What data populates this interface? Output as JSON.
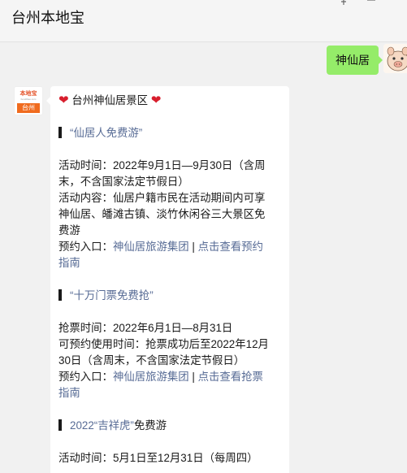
{
  "window": {
    "title": "台州本地宝",
    "pin_icon": "pin-icon",
    "minimize_icon": "minimize-icon"
  },
  "outgoing": {
    "text": "神仙居"
  },
  "incoming": {
    "avatar": {
      "brand": "本地宝",
      "domain": "bendibao.com",
      "city": "台州"
    },
    "header": "台州神仙居景区",
    "sec1": {
      "title": "“仙居人免费游”",
      "time_l1": "活动时间：2022年9月1日—9月30日（含周",
      "time_l2": "末，不含国家法定节假日）",
      "content_l1": "活动内容：仙居户籍市民在活动期间内可享",
      "content_l2": "神仙居、皤滩古镇、淡竹休闲谷三大景区免",
      "content_l3": "费游",
      "entry_label": "预约入口：",
      "entry_link1": "神仙居旅游集团",
      "entry_sep": " | ",
      "entry_link2_l1": "点击查看预约",
      "entry_link2_l2": "指南"
    },
    "sec2": {
      "title": "“十万门票免费抢”",
      "grab_time": "抢票时间：2022年6月1日—8月31日",
      "use_l1": "可预约使用时间：抢票成功后至2022年12月",
      "use_l2": "30日（含周末，不含国家法定节假日）",
      "entry_label": "预约入口：",
      "entry_link1": "神仙居旅游集团",
      "entry_sep": " | ",
      "entry_link2_l1": "点击查看抢票",
      "entry_link2_l2": "指南"
    },
    "sec3": {
      "title_accent": "2022“吉祥虎”",
      "title_rest": "免费游",
      "time_partial": "活动时间：5月1日至12月31日（每周四）"
    }
  },
  "colors": {
    "link": "#576b95",
    "outgoing_bubble": "#95ec69",
    "heart": "#d81e2d",
    "background": "#f1f1f1"
  }
}
